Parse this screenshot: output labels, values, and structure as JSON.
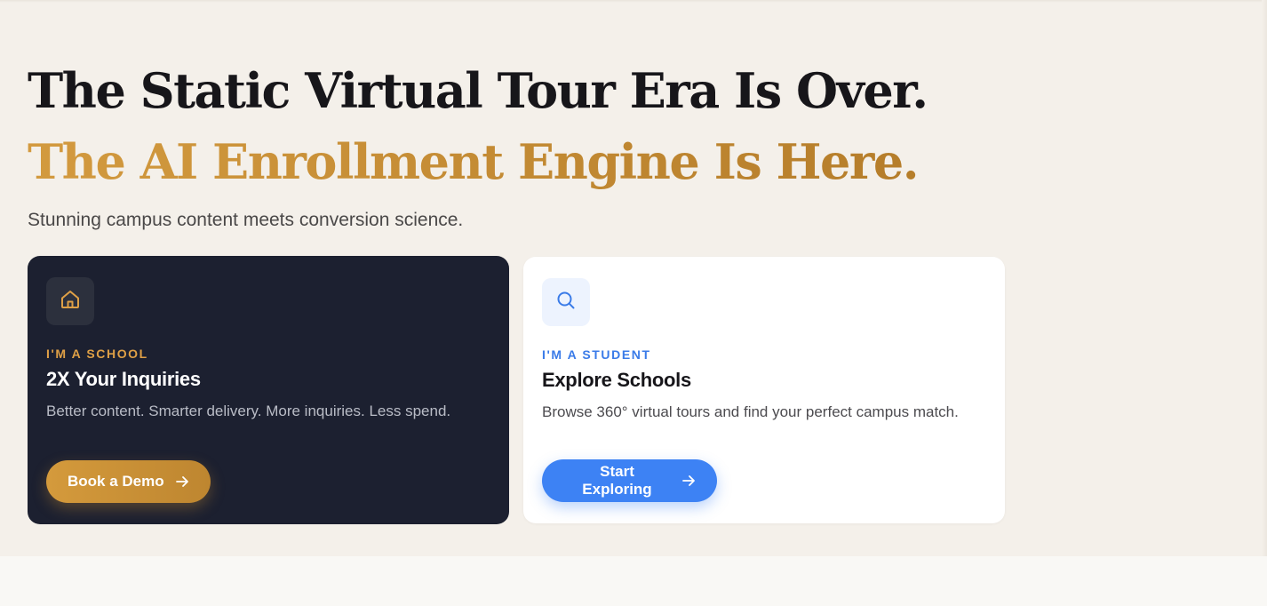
{
  "hero": {
    "headline_line1": "The Static Virtual Tour Era Is Over.",
    "headline_line2": "The AI Enrollment Engine Is Here.",
    "subtitle": "Stunning campus content meets conversion science."
  },
  "cards": {
    "school": {
      "icon": "home-icon",
      "eyebrow": "I'M A SCHOOL",
      "title": "2X Your Inquiries",
      "description": "Better content. Smarter delivery. More inquiries. Less spend.",
      "button_label": "Book a Demo"
    },
    "student": {
      "icon": "search-icon",
      "eyebrow": "I'M A STUDENT",
      "title": "Explore Schools",
      "description": "Browse 360° virtual tours and find your perfect campus match.",
      "button_label": "Start Exploring"
    }
  },
  "colors": {
    "accent_gold": "#d39a3f",
    "accent_blue": "#3d82f4",
    "dark_card": "#1c2030",
    "background": "#f4f0ea"
  }
}
